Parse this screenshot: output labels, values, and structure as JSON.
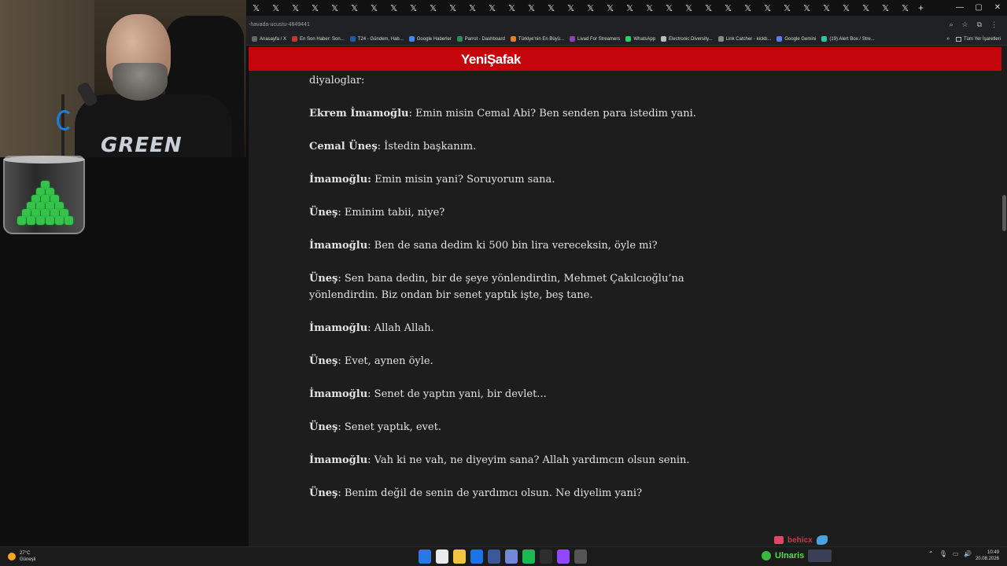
{
  "browser": {
    "tab_glyph": "𝕏",
    "tab_count": 34,
    "new_tab_glyph": "+",
    "window_controls": [
      "—",
      "▢",
      "✕"
    ],
    "url": "-havada-ucustu-4849441",
    "bookmarks": [
      {
        "label": "Anasayfa / X",
        "color": "#666666"
      },
      {
        "label": "En Son Haber: Son...",
        "color": "#c0392b"
      },
      {
        "label": "T24 - Gündem, Hab...",
        "color": "#1e5aa8"
      },
      {
        "label": "Google Haberler",
        "color": "#4285f4"
      },
      {
        "label": "Parrot - Dashboard",
        "color": "#2e8b57"
      },
      {
        "label": "Türkiye'nin En Büyü...",
        "color": "#e67e22"
      },
      {
        "label": "Livad For Streamers",
        "color": "#8e44ad"
      },
      {
        "label": "WhatsApp",
        "color": "#25d366"
      },
      {
        "label": "Electronic Diversity...",
        "color": "#bbbbbb"
      },
      {
        "label": "Link Catcher - kickb...",
        "color": "#888888"
      },
      {
        "label": "Google Gemini",
        "color": "#5a7ef0"
      },
      {
        "label": "(19) Alert Box / Stre...",
        "color": "#31c3a2"
      }
    ],
    "bookmarks_more": "»",
    "all_bookmarks": "Tüm Yer İşaretleri"
  },
  "site": {
    "logo": "YeniŞafak"
  },
  "article": {
    "lead": "diyaloglar:",
    "lines": [
      {
        "speaker": "Ekrem İmamoğlu",
        "text": ": Emin misin Cemal Abi? Ben senden para istedim yani."
      },
      {
        "speaker": "Cemal Üneş",
        "text": ": İstedin başkanım."
      },
      {
        "speaker": "İmamoğlu:",
        "text": " Emin misin yani? Soruyorum sana."
      },
      {
        "speaker": "Üneş",
        "text": ": Eminim tabii, niye?"
      },
      {
        "speaker": "İmamoğlu",
        "text": ": Ben de sana dedim ki 500 bin lira vereceksin, öyle mi?"
      },
      {
        "speaker": "Üneş",
        "text": ": Sen bana dedin, bir de şeye yönlendirdin, Mehmet Çakılcıoğlu’na yönlendirdin. Biz ondan bir senet yaptık işte, beş tane."
      },
      {
        "speaker": "İmamoğlu",
        "text": ": Allah Allah."
      },
      {
        "speaker": "Üneş",
        "text": ": Evet, aynen öyle."
      },
      {
        "speaker": "İmamoğlu",
        "text": ": Senet de yaptın yani, bir devlet..."
      },
      {
        "speaker": "Üneş",
        "text": ": Senet yaptık, evet."
      },
      {
        "speaker": "İmamoğlu",
        "text": ": Vah ki ne vah, ne diyeyim sana? Allah yardımcın olsun senin."
      },
      {
        "speaker": "Üneş",
        "text": ": Benim değil de senin de yardımcı olsun. Ne diyelim yani?"
      }
    ]
  },
  "stream": {
    "shirt_text": "GREEN",
    "chat_user": "behicx"
  },
  "taskbar": {
    "weather_temp": "27°C",
    "weather_desc": "Güneşli",
    "tray_user": "Ulnaris",
    "time": "10:49",
    "date": "20.08.2026",
    "app_colors": [
      "#2b78e4",
      "#e8eaed",
      "#f4c542",
      "#1a73e8",
      "#3b5998",
      "#7289da",
      "#1db954",
      "#2e2e2e",
      "#9146ff",
      "#555555"
    ]
  }
}
